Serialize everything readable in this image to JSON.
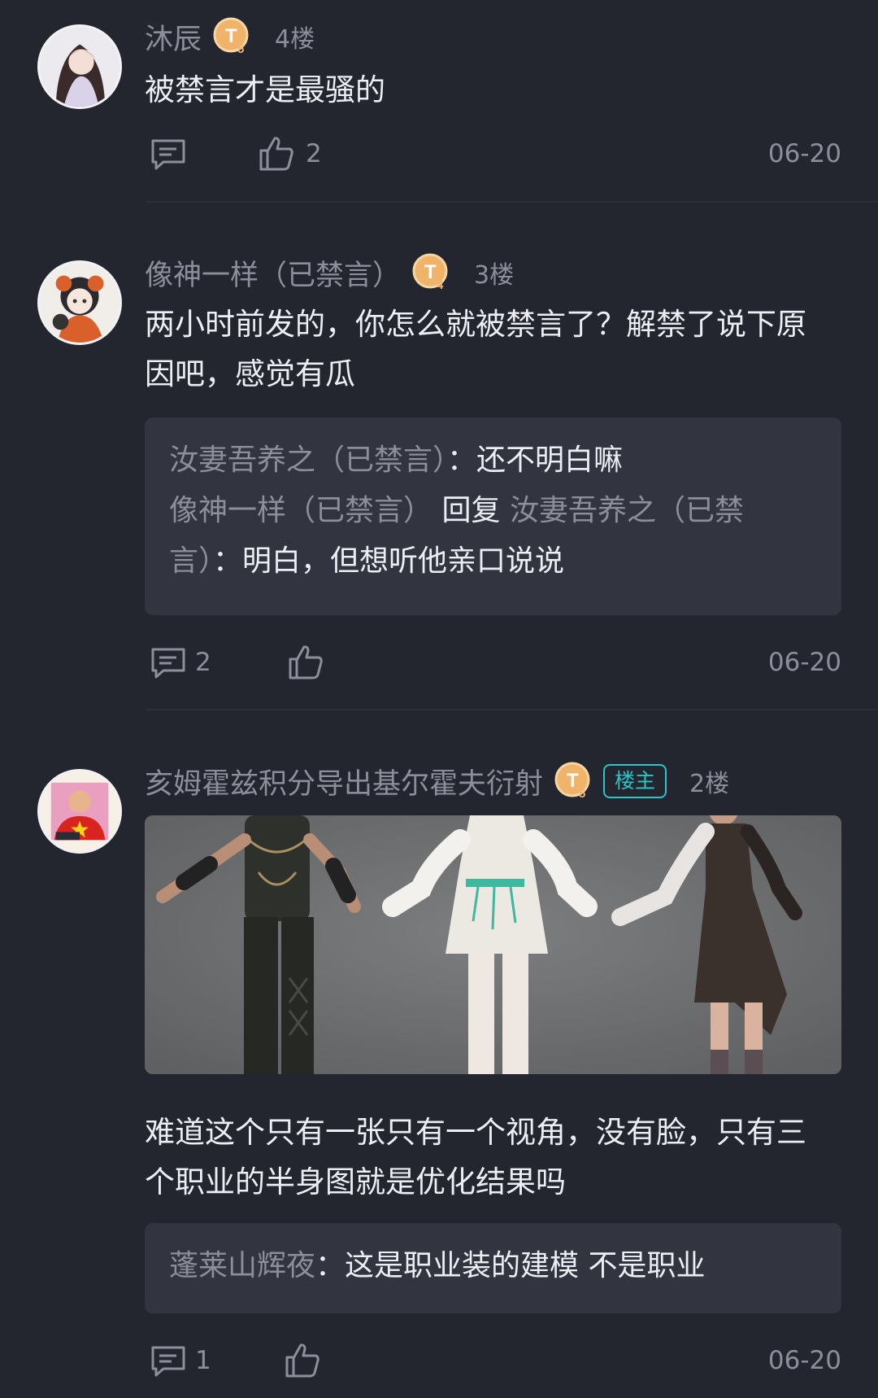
{
  "comments": [
    {
      "username": "沐辰",
      "level": "5",
      "floor": "4楼",
      "text": [
        "被禁言才是最骚的"
      ],
      "reply_count": "",
      "like_count": "2",
      "date": "06-20"
    },
    {
      "username": "像神一样（已禁言）",
      "level": "4",
      "floor": "3楼",
      "text": [
        "两小时前发的，你怎么就被禁言了？解禁了说下原",
        "因吧，感觉有瓜"
      ],
      "replies": [
        {
          "from": "汝妻吾养之（已禁言）",
          "sep": "：",
          "text": "还不明白嘛"
        },
        {
          "from": "像神一样（已禁言）",
          "verb": "回复",
          "to_line1": "汝妻吾养之（已禁",
          "to_line2": "言）",
          "sep": "：",
          "text": "明白，但想听他亲口说说"
        }
      ],
      "reply_count": "2",
      "like_count": "",
      "date": "06-20"
    },
    {
      "username": "亥姆霍兹积分导出基尔霍夫衍射",
      "level": "5",
      "op_tag": "楼主",
      "floor": "2楼",
      "text": [
        "难道这个只有一张只有一个视角，没有脸，只有三",
        "个职业的半身图就是优化结果吗"
      ],
      "replies": [
        {
          "from": "蓬莱山辉夜",
          "sep": "：",
          "text": "这是职业装的建模 不是职业"
        }
      ],
      "reply_count": "1",
      "like_count": "",
      "date": "06-20"
    }
  ],
  "colors": {
    "background": "#23252f",
    "reply_box": "#32353f",
    "muted_text": "#8c8f9b",
    "op_tag": "#2ec4c9",
    "level_badge": "#f0b36a"
  },
  "icons": {
    "comment": "comment-bubble-icon",
    "like": "thumbs-up-icon",
    "level": "level-badge-icon"
  }
}
